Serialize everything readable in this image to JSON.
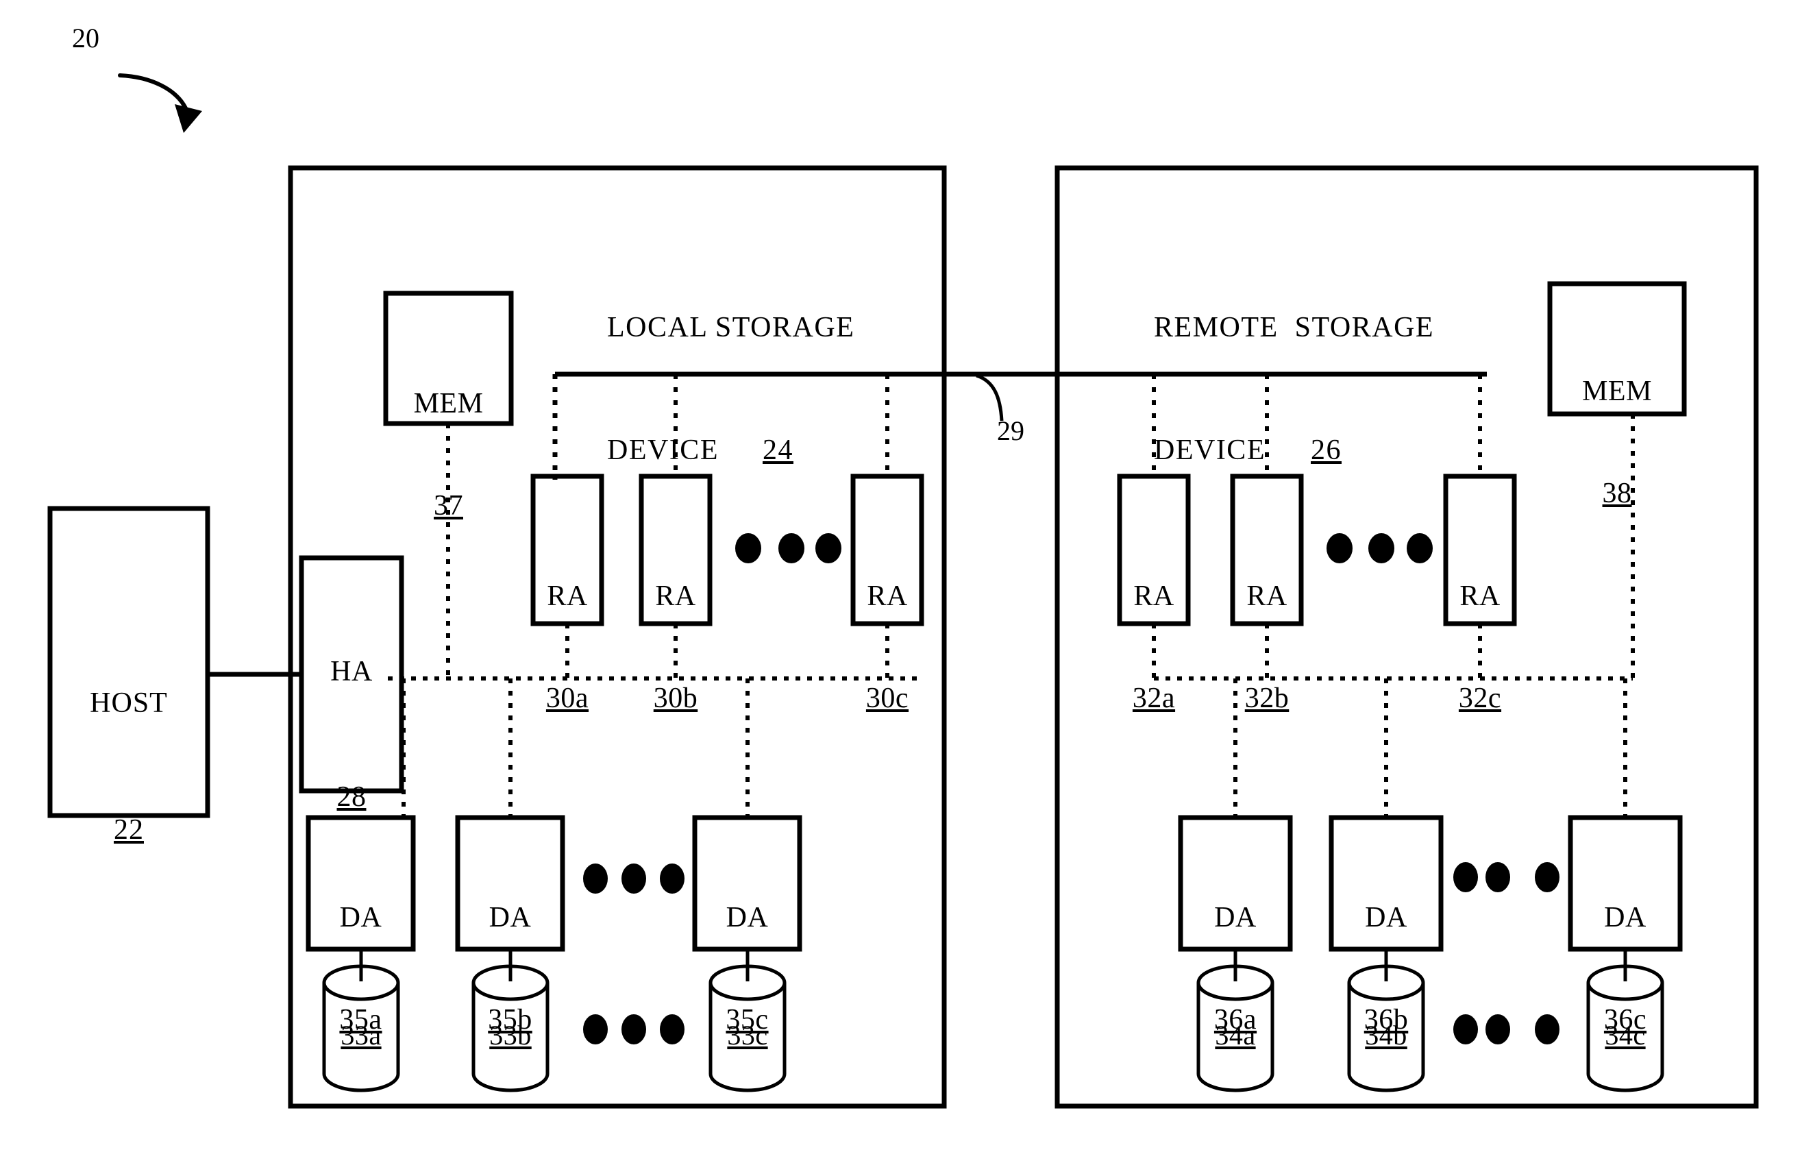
{
  "figure": {
    "ref_number": "20"
  },
  "host": {
    "label": "HOST",
    "ref": "22"
  },
  "local_device": {
    "title_line1": "LOCAL STORAGE",
    "title_line2": "DEVICE",
    "ref": "24",
    "mem": {
      "label": "MEM",
      "ref": "37"
    },
    "ha": {
      "label": "HA",
      "ref": "28"
    },
    "ras": [
      {
        "label": "RA",
        "ref": "30a"
      },
      {
        "label": "RA",
        "ref": "30b"
      },
      {
        "label": "RA",
        "ref": "30c"
      }
    ],
    "das": [
      {
        "label": "DA",
        "ref": "35a"
      },
      {
        "label": "DA",
        "ref": "35b"
      },
      {
        "label": "DA",
        "ref": "35c"
      }
    ],
    "disks": [
      {
        "ref": "33a"
      },
      {
        "ref": "33b"
      },
      {
        "ref": "33c"
      }
    ]
  },
  "remote_device": {
    "title_line1": "REMOTE  STORAGE",
    "title_line2": "DEVICE",
    "ref": "26",
    "mem": {
      "label": "MEM",
      "ref": "38"
    },
    "ras": [
      {
        "label": "RA",
        "ref": "32a"
      },
      {
        "label": "RA",
        "ref": "32b"
      },
      {
        "label": "RA",
        "ref": "32c"
      }
    ],
    "das": [
      {
        "label": "DA",
        "ref": "36a"
      },
      {
        "label": "DA",
        "ref": "36b"
      },
      {
        "label": "DA",
        "ref": "36c"
      }
    ],
    "disks": [
      {
        "ref": "34a"
      },
      {
        "ref": "34b"
      },
      {
        "ref": "34c"
      }
    ]
  },
  "link": {
    "ref": "29"
  },
  "colors": {
    "stroke": "#000000",
    "background": "#ffffff"
  }
}
